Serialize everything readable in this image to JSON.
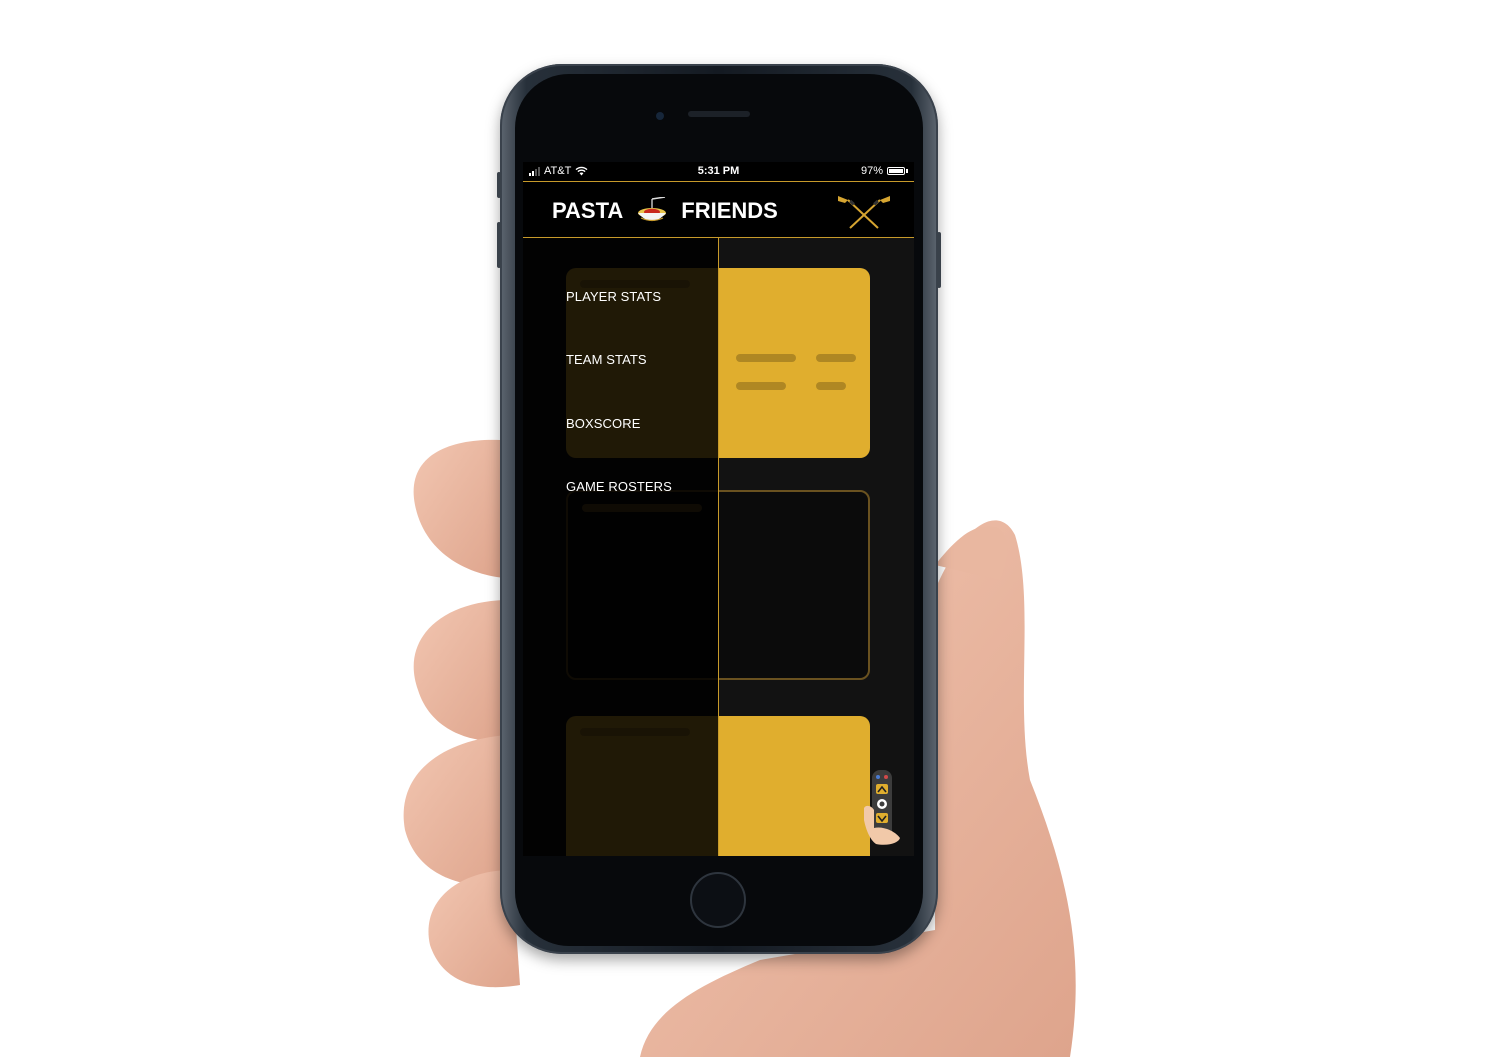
{
  "status_bar": {
    "carrier": "AT&T",
    "time": "5:31 PM",
    "battery_percent": "97%",
    "battery_level": 0.97,
    "signal_bars": 2,
    "wifi_icon": "wifi-icon"
  },
  "header": {
    "brand_left": "PASTA",
    "brand_right": "FRIENDS",
    "logo_icon": "spaghetti-bowl-icon",
    "menu_icon": "crossed-hockey-sticks-icon"
  },
  "drawer": {
    "items": [
      {
        "label": "PLAYER STATS"
      },
      {
        "label": "TEAM STATS"
      },
      {
        "label": "BOXSCORE"
      },
      {
        "label": "GAME ROSTERS"
      }
    ]
  },
  "fab": {
    "icon": "tv-remote-icon"
  },
  "colors": {
    "accent": "#c79a2a",
    "card_yellow": "#e0ae2e",
    "background": "#000000",
    "text": "#ffffff"
  }
}
